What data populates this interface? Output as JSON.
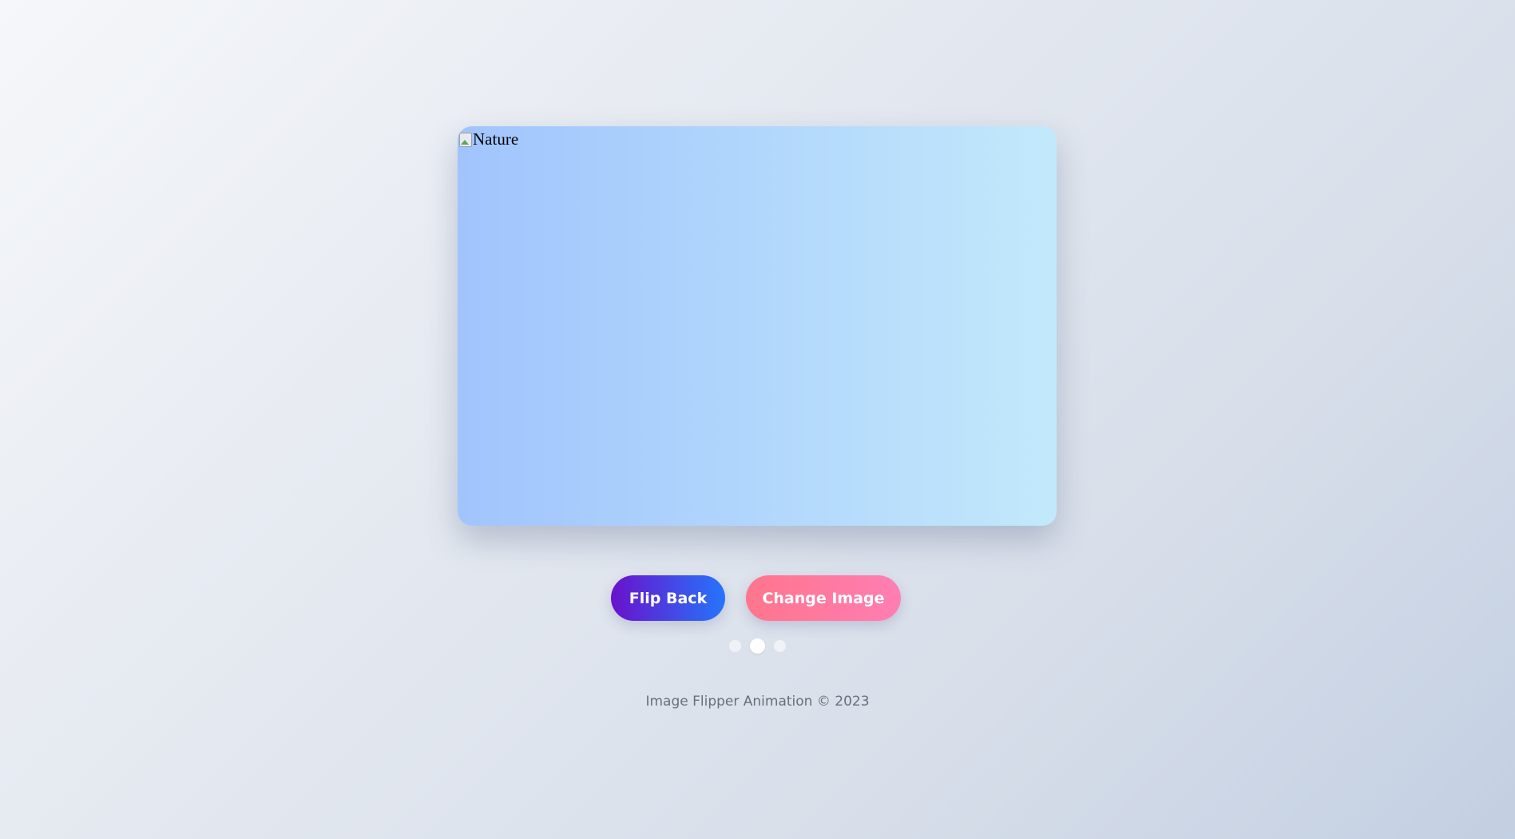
{
  "card": {
    "image_alt": "Nature",
    "gradient_start": "#a1c4fd",
    "gradient_end": "#c2e9fb"
  },
  "controls": {
    "flip_back_label": "Flip Back",
    "change_image_label": "Change Image",
    "flip_back_colors": [
      "#6a11cb",
      "#2575fc"
    ],
    "change_image_colors": [
      "#ff758c",
      "#ff7eb3"
    ]
  },
  "indicators": {
    "count": 3,
    "active_index": 1
  },
  "footer": {
    "text": "Image Flipper Animation © 2023"
  }
}
